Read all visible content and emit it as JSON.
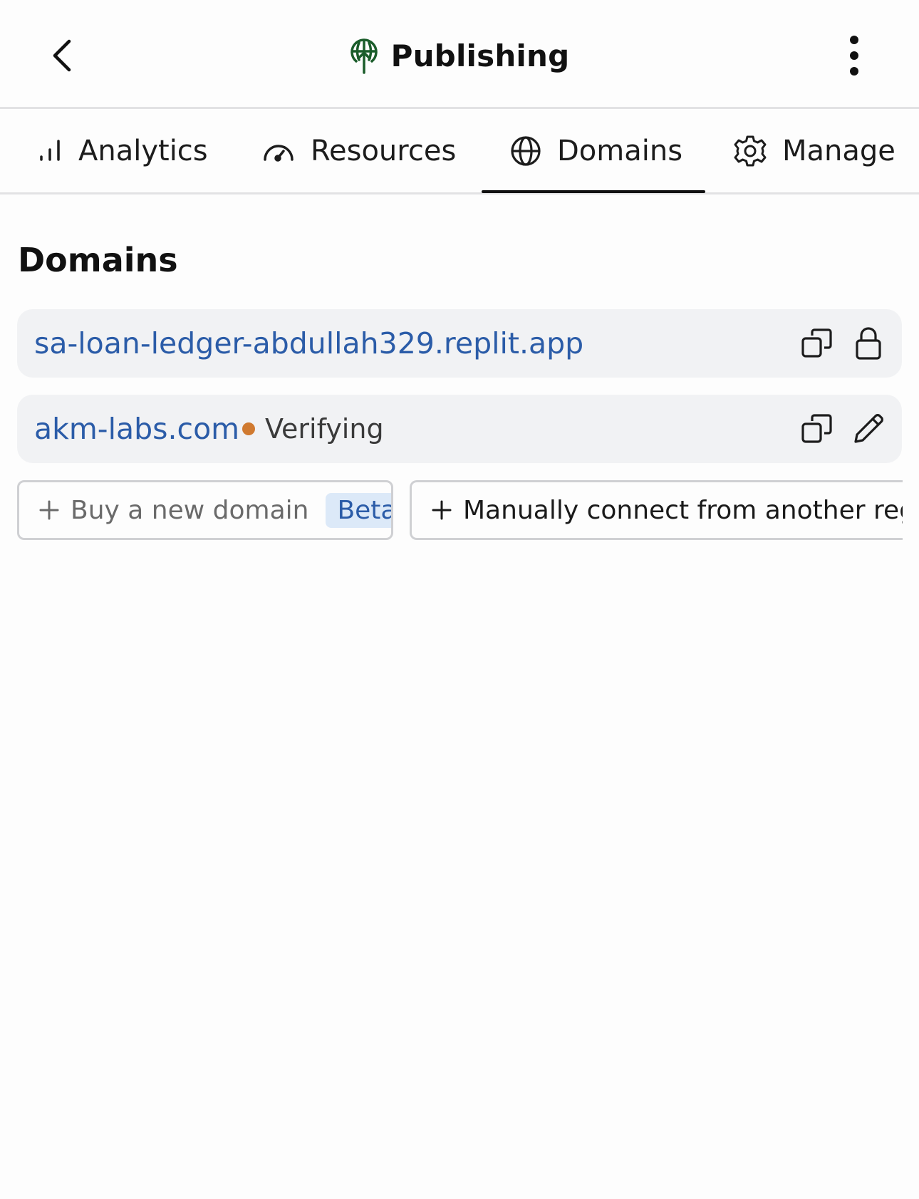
{
  "header": {
    "title": "Publishing",
    "back_icon": "chevron-left-icon",
    "more_icon": "kebab-menu-icon",
    "title_icon": "publish-tree-icon",
    "accent_color": "#1a5c2a"
  },
  "tabs": [
    {
      "label": "Analytics",
      "icon": "bar-chart-icon",
      "active": false
    },
    {
      "label": "Resources",
      "icon": "gauge-icon",
      "active": false
    },
    {
      "label": "Domains",
      "icon": "globe-icon",
      "active": true
    },
    {
      "label": "Manage",
      "icon": "gear-icon",
      "active": false
    }
  ],
  "section": {
    "title": "Domains"
  },
  "domains": [
    {
      "name": "sa-loan-ledger-abdullah329.replit.app",
      "status": "",
      "actions": [
        "copy-icon",
        "lock-icon"
      ]
    },
    {
      "name": "akm-labs.com",
      "status": "Verifying",
      "status_color": "#d07a30",
      "actions": [
        "copy-icon",
        "pencil-icon"
      ]
    }
  ],
  "buttons": {
    "buy_label": "Buy a new domain",
    "buy_badge": "Beta",
    "manual_label": "Manually connect from another registrar"
  },
  "colors": {
    "link": "#2b5ca8",
    "badge_bg": "#dce9f8"
  }
}
